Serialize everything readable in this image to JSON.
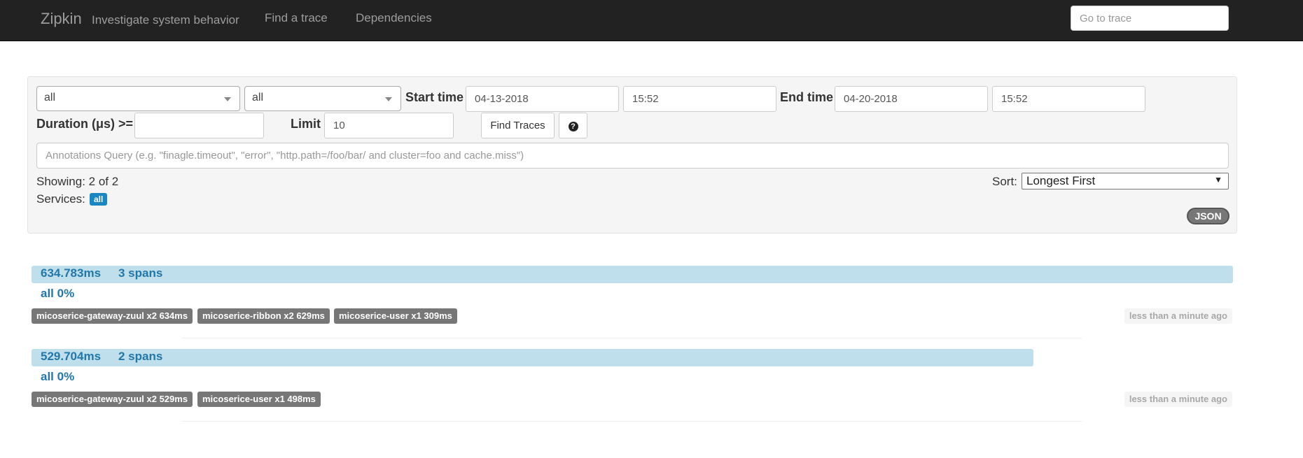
{
  "navbar": {
    "brand": "Zipkin",
    "tagline": "Investigate system behavior",
    "links": [
      "Find a trace",
      "Dependencies"
    ],
    "goto_placeholder": "Go to trace"
  },
  "search": {
    "service_select": "all",
    "span_select": "all",
    "start_time_label": "Start time",
    "start_date": "04-13-2018",
    "start_clock": "15:52",
    "end_time_label": "End time",
    "end_date": "04-20-2018",
    "end_clock": "15:52",
    "duration_label": "Duration (μs) >=",
    "duration_value": "",
    "limit_label": "Limit",
    "limit_value": "10",
    "find_button": "Find Traces",
    "annotations_placeholder": "Annotations Query (e.g. \"finagle.timeout\", \"error\", \"http.path=/foo/bar/ and cluster=foo and cache.miss\")",
    "showing": "Showing: 2 of 2",
    "services_label": "Services:",
    "services_badge": "all",
    "sort_label": "Sort:",
    "sort_value": "Longest First",
    "json_button": "JSON"
  },
  "traces": [
    {
      "duration": "634.783ms",
      "spans": "3 spans",
      "bar_fraction": 1.0,
      "service_pct": "all 0%",
      "tags": [
        "micoserice-gateway-zuul x2 634ms",
        "micoserice-ribbon x2 629ms",
        "micoserice-user x1 309ms"
      ],
      "timestamp": "less than a minute ago"
    },
    {
      "duration": "529.704ms",
      "spans": "2 spans",
      "bar_fraction": 0.834,
      "service_pct": "all 0%",
      "tags": [
        "micoserice-gateway-zuul x2 529ms",
        "micoserice-user x1 498ms"
      ],
      "timestamp": "less than a minute ago"
    }
  ],
  "colors": {
    "navbar_bg": "#222222",
    "trace_bar": "#bfdfed",
    "accent_blue": "#2277a8",
    "badge_blue": "#1a87c2",
    "tag_gray": "#777777"
  }
}
